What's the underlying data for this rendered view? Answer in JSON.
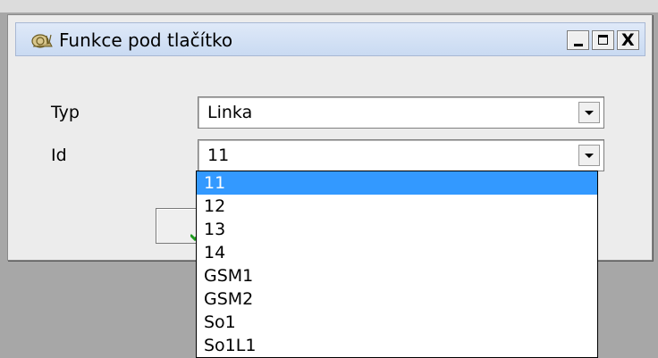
{
  "window": {
    "title": "Funkce pod tlačítko",
    "minimize_symbol": "_",
    "maximize_symbol": "□",
    "close_symbol": "X"
  },
  "form": {
    "type_label": "Typ",
    "type_value": "Linka",
    "id_label": "Id",
    "id_value": "11"
  },
  "dropdown": {
    "items": [
      "11",
      "12",
      "13",
      "14",
      "GSM1",
      "GSM2",
      "So1",
      "So1L1"
    ],
    "selected_index": 0,
    "highlight_color": "#3399ff"
  },
  "icons": {
    "app": "snail-icon",
    "ok_button": "check-icon"
  }
}
